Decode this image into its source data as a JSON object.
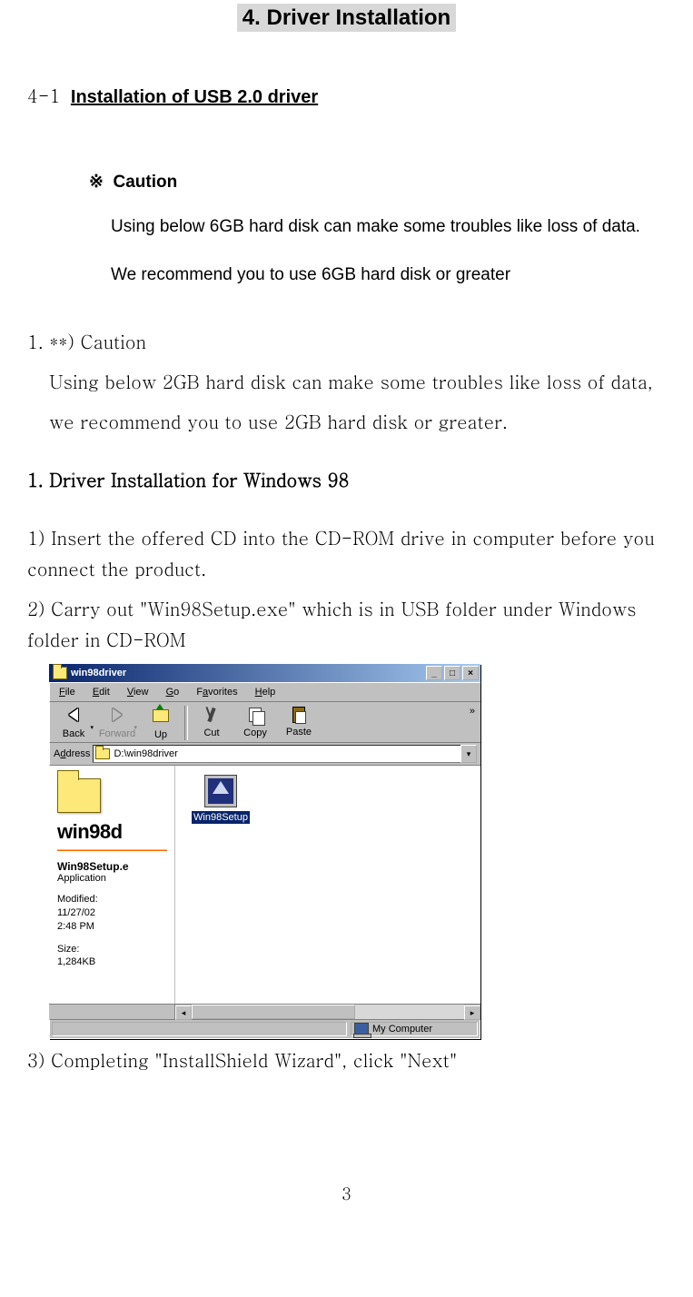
{
  "chapter_title": "4. Driver Installation",
  "section": {
    "num": "4-1",
    "title": "Installation of USB 2.0 driver"
  },
  "caution_block": {
    "symbol": "※",
    "head": "Caution",
    "line1": "Using below 6GB hard disk can make some troubles like loss of data.",
    "line2": "We recommend you to use 6GB hard disk or greater"
  },
  "caution_numbered": {
    "head": "1. **) Caution",
    "line1": "Using below 2GB hard disk can make some troubles like loss of data,",
    "line2": "we recommend you to use 2GB hard disk or greater."
  },
  "sub_heading": "1. Driver Installation for Windows 98",
  "steps": {
    "s1": "1) Insert the offered CD into the CD-ROM drive in computer before you connect the product.",
    "s2": "2) Carry out \"Win98Setup.exe\" which is in USB folder under Windows folder in CD-ROM",
    "s3": "3) Completing \"InstallShield Wizard\", click \"Next\""
  },
  "win": {
    "title": "win98driver",
    "menu": {
      "file": "File",
      "edit": "Edit",
      "view": "View",
      "go": "Go",
      "fav": "Favorites",
      "help": "Help"
    },
    "tb": {
      "back": "Back",
      "forward": "Forward",
      "up": "Up",
      "cut": "Cut",
      "copy": "Copy",
      "paste": "Paste"
    },
    "addr_label": "Address",
    "addr_value": "D:\\win98driver",
    "left": {
      "title": "win98d",
      "file_name": "Win98Setup.e",
      "file_type": "Application",
      "mod_label": "Modified:",
      "mod_date": "11/27/02",
      "mod_time": "2:48 PM",
      "size_label": "Size:",
      "size_value": "1,284KB"
    },
    "file_label": "Win98Setup",
    "status_right": "My Computer"
  },
  "page_number": "3"
}
